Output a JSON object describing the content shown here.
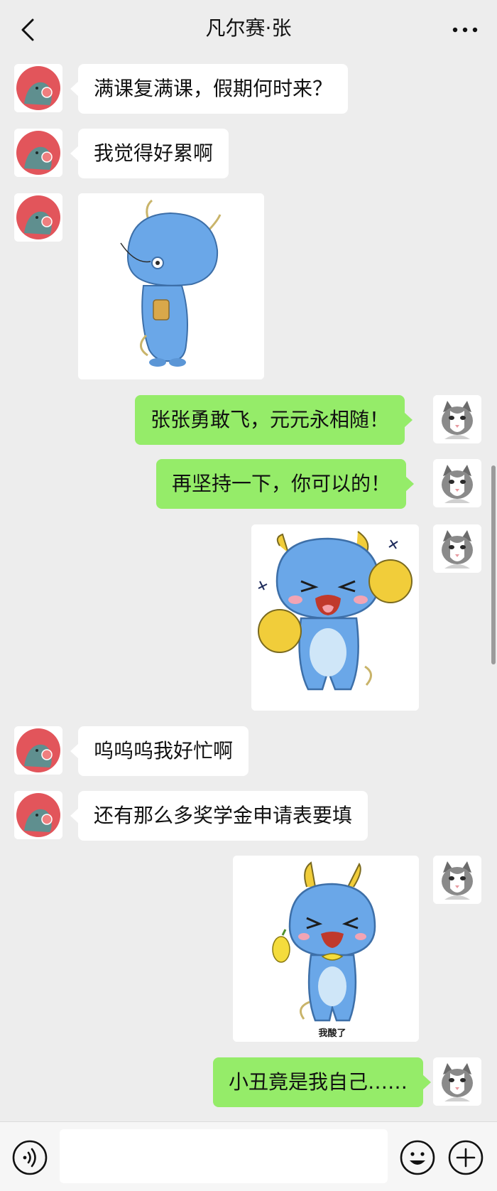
{
  "header": {
    "title": "凡尔赛·张",
    "back_icon": "chevron-left-icon",
    "more_icon": "more-dots-icon"
  },
  "messages": [
    {
      "side": "in",
      "type": "text",
      "text": "满课复满课，假期何时来？"
    },
    {
      "side": "in",
      "type": "text",
      "text": "我觉得好累啊"
    },
    {
      "side": "in",
      "type": "sticker",
      "sticker": "blue-dragon-bored-sticker"
    },
    {
      "side": "out",
      "type": "text",
      "text": "张张勇敢飞，元元永相随！"
    },
    {
      "side": "out",
      "type": "text",
      "text": "再坚持一下，你可以的！"
    },
    {
      "side": "out",
      "type": "sticker",
      "sticker": "blue-dragon-cheering-sticker"
    },
    {
      "side": "in",
      "type": "text",
      "text": "呜呜呜我好忙啊"
    },
    {
      "side": "in",
      "type": "text",
      "text": "还有那么多奖学金申请表要填"
    },
    {
      "side": "out",
      "type": "sticker",
      "sticker": "blue-dragon-lemon-sticker",
      "caption": "我酸了"
    },
    {
      "side": "out",
      "type": "text",
      "text": "小丑竟是我自己……"
    }
  ],
  "input_bar": {
    "voice_icon": "voice-icon",
    "text_value": "",
    "emoji_icon": "emoji-icon",
    "plus_icon": "plus-icon"
  },
  "colors": {
    "background": "#ededed",
    "bubble_in": "#ffffff",
    "bubble_out": "#95ec69",
    "friend_avatar": "#e2555b",
    "dragon_blue": "#5b9be0"
  }
}
